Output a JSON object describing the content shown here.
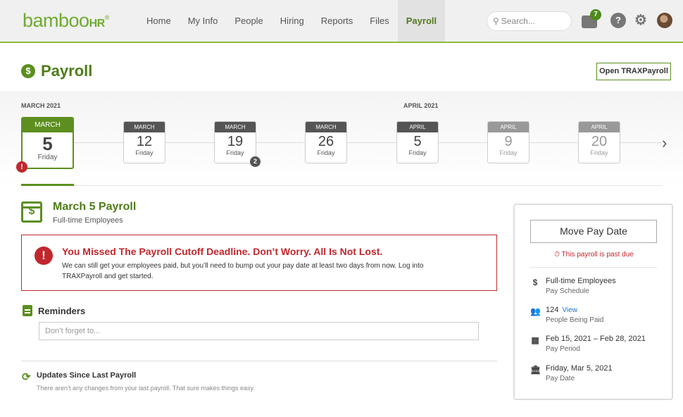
{
  "app": {
    "logo_main": "bamboo",
    "logo_suffix": "HR"
  },
  "nav": {
    "items": [
      "Home",
      "My Info",
      "People",
      "Hiring",
      "Reports",
      "Files",
      "Payroll"
    ],
    "active": "Payroll"
  },
  "search": {
    "placeholder": "Search..."
  },
  "topbar": {
    "inbox_count": "7",
    "help_glyph": "?",
    "settings_glyph": "⚙"
  },
  "page": {
    "title": "Payroll",
    "open_trax_label": "Open TRAXPayroll"
  },
  "timeline": {
    "month_labels": [
      "MARCH 2021",
      "APRIL 2021"
    ],
    "dates": [
      {
        "month": "MARCH",
        "day": "5",
        "weekday": "Friday",
        "state": "selected"
      },
      {
        "month": "MARCH",
        "day": "12",
        "weekday": "Friday",
        "state": "normal"
      },
      {
        "month": "MARCH",
        "day": "19",
        "weekday": "Friday",
        "state": "normal"
      },
      {
        "month": "MARCH",
        "day": "26",
        "weekday": "Friday",
        "state": "normal"
      },
      {
        "month": "APRIL",
        "day": "5",
        "weekday": "Friday",
        "state": "normal"
      },
      {
        "month": "APRIL",
        "day": "9",
        "weekday": "Friday",
        "state": "future"
      },
      {
        "month": "APRIL",
        "day": "20",
        "weekday": "Friday",
        "state": "future"
      }
    ],
    "selected_alert": "!",
    "march19_count": "2",
    "next_arrow": "›"
  },
  "payroll": {
    "title": "March 5 Payroll",
    "subtitle": "Full-time Employees",
    "calendar_glyph": "$"
  },
  "alert": {
    "title": "You Missed The Payroll Cutoff Deadline. Don’t Worry. All Is Not Lost.",
    "body": "We can still get your employees paid, but you’ll need to bump out your pay date at least two days from now. Log into TRAXPayroll and get started."
  },
  "reminders": {
    "title": "Reminders",
    "placeholder": "Don’t forget to..."
  },
  "updates": {
    "title": "Updates Since Last Payroll",
    "message": "There aren’t any changes from your last payroll. That sure makes things easy."
  },
  "panel": {
    "move_button": "Move Pay Date",
    "past_due": "⏱ This payroll is past due",
    "rows": [
      {
        "icon": "$",
        "title": "Full-time Employees",
        "sub": "Pay Schedule"
      },
      {
        "icon": "👥",
        "title": "124",
        "link": "View",
        "sub": "People Being Paid"
      },
      {
        "icon": "▦",
        "title": "Feb 15, 2021 – Feb 28, 2021",
        "sub": "Pay Period"
      },
      {
        "icon": "🏛",
        "title": "Friday, Mar 5, 2021",
        "sub": "Pay Date"
      }
    ]
  },
  "colors": {
    "brand": "#5c8f1f",
    "alert": "#c0272d",
    "link": "#1a73c8"
  }
}
